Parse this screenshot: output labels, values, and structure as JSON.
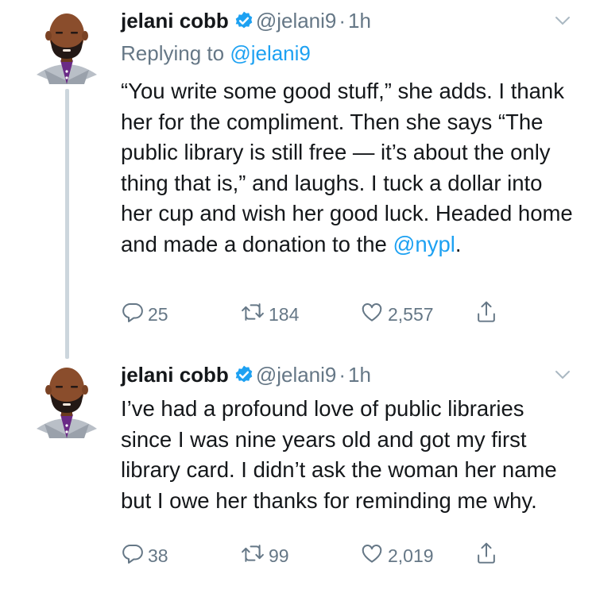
{
  "tweets": [
    {
      "author": {
        "name": "jelani cobb",
        "handle": "@jelani9"
      },
      "time": "1h",
      "dot": "·",
      "replying": {
        "prefix": "Replying to",
        "handle": "@jelani9"
      },
      "text": "“You write some good stuff,” she adds. I thank her for the compliment. Then she says “The public library is still free — it’s about the only thing that is,” and laughs. I tuck a dollar into her cup and wish her good luck. Headed home and made a donation to the ",
      "mention": "@nypl",
      "text_end": ".",
      "actions": {
        "replies": "25",
        "retweets": "184",
        "likes": "2,557"
      }
    },
    {
      "author": {
        "name": "jelani cobb",
        "handle": "@jelani9"
      },
      "time": "1h",
      "dot": "·",
      "text": "I’ve had a profound love of public libraries since I was nine years old and got my first library card. I didn’t ask the woman her name but I owe her thanks for reminding me why.",
      "actions": {
        "replies": "38",
        "retweets": "99",
        "likes": "2,019"
      }
    }
  ],
  "colors": {
    "text": "#14171a",
    "secondary": "#657786",
    "link": "#1da1f2",
    "verified": "#1da1f2",
    "thread": "#ccd6dd"
  },
  "icons": [
    "avatar-illustration",
    "verified-badge-icon",
    "chevron-down-icon",
    "reply-icon",
    "retweet-icon",
    "like-icon",
    "share-icon"
  ]
}
